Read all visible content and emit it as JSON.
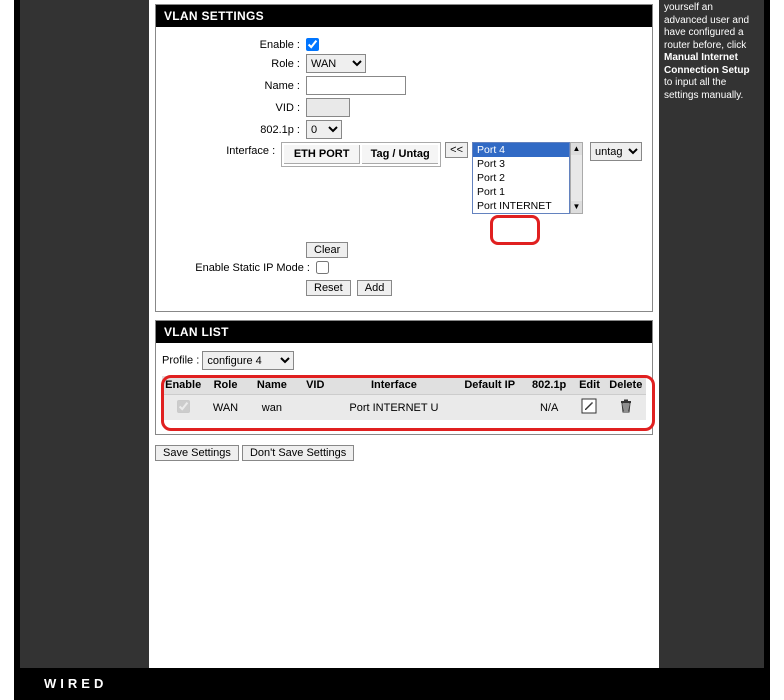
{
  "settings": {
    "header": "VLAN SETTINGS",
    "enable_label": "Enable :",
    "enable_checked": true,
    "role_label": "Role :",
    "role_value": "WAN",
    "name_label": "Name :",
    "name_value": "",
    "vid_label": "VID :",
    "vid_value": "",
    "p8021_label": "802.1p :",
    "p8021_value": "0",
    "interface_label": "Interface :",
    "eth_port_header": "ETH PORT",
    "tag_untag_header": "Tag / Untag",
    "shuttle_btn": "<<",
    "port_options": [
      "Port 4",
      "Port 3",
      "Port 2",
      "Port 1",
      "Port INTERNET"
    ],
    "port_selected_index": 0,
    "untag_value": "untag",
    "clear_btn": "Clear",
    "static_ip_label": "Enable Static IP Mode :",
    "static_ip_checked": false,
    "reset_btn": "Reset",
    "add_btn": "Add"
  },
  "list": {
    "header": "VLAN LIST",
    "profile_label": "Profile :",
    "profile_value": "configure 4",
    "columns": {
      "enable": "Enable",
      "role": "Role",
      "name": "Name",
      "vid": "VID",
      "interface": "Interface",
      "default_ip": "Default IP",
      "p8021": "802.1p",
      "edit": "Edit",
      "delete": "Delete"
    },
    "rows": [
      {
        "enable_checked": true,
        "role": "WAN",
        "name": "wan",
        "vid": "",
        "interface": "Port INTERNET U",
        "default_ip": "",
        "p8021": "N/A"
      }
    ]
  },
  "buttons": {
    "save": "Save Settings",
    "dont_save": "Don't Save Settings"
  },
  "sidebar": {
    "text1": "yourself an advanced user and have configured a router before, click ",
    "bold": "Manual Internet Connection Setup",
    "text2": " to input all the settings manually."
  },
  "footer": "WIRED"
}
